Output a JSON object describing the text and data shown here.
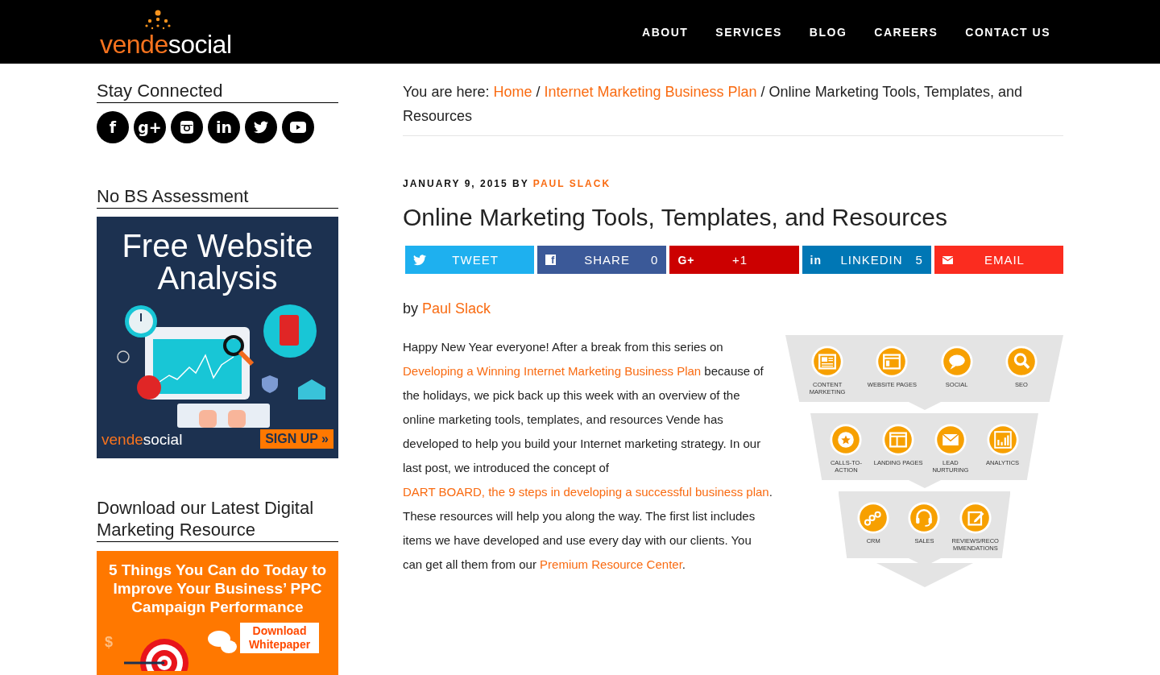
{
  "header": {
    "logo": {
      "first": "vende",
      "second": "social"
    },
    "nav": [
      {
        "label": "ABOUT"
      },
      {
        "label": "SERVICES"
      },
      {
        "label": "BLOG"
      },
      {
        "label": "CAREERS"
      },
      {
        "label": "CONTACT US"
      }
    ]
  },
  "sidebar": {
    "stay_connected": {
      "title": "Stay Connected",
      "icons": [
        {
          "kind": "glyph",
          "glyph": "f"
        },
        {
          "kind": "glyph",
          "glyph": "g+"
        },
        {
          "kind": "camera"
        },
        {
          "kind": "glyph",
          "glyph": "in"
        },
        {
          "kind": "bird"
        },
        {
          "kind": "play"
        }
      ]
    },
    "assessment": {
      "title": "No BS Assessment",
      "banner": {
        "headline": "Free Website Analysis",
        "logo_first": "vende",
        "logo_second": "social",
        "button": "SIGN UP »"
      }
    },
    "resource": {
      "title": "Download our Latest Digital Marketing Resource",
      "banner": {
        "headline": "5 Things You Can do Today to Improve Your Business’ PPC Campaign Performance",
        "button": "Download Whitepaper",
        "symbol": "$"
      }
    }
  },
  "breadcrumb": [
    {
      "text": "You are here: ",
      "link": false
    },
    {
      "text": "Home",
      "link": true
    },
    {
      "text": " / ",
      "link": false
    },
    {
      "text": "Internet Marketing Business Plan",
      "link": true
    },
    {
      "text": " / Online Marketing Tools, Templates, and Resources",
      "link": false
    }
  ],
  "post": {
    "date": "JANUARY 9, 2015",
    "by": "BY",
    "author": "PAUL SLACK",
    "title": "Online Marketing Tools, Templates, and Resources",
    "share": [
      {
        "kind": "bird",
        "label": "TWEET",
        "color": "#1eb0ef"
      },
      {
        "kind": "fbox",
        "glyph": "f",
        "label": "SHARE",
        "count": "0",
        "color": "#3b5998"
      },
      {
        "kind": "glyph",
        "glyph": "G+",
        "label": "+1",
        "color": "#cc0000"
      },
      {
        "kind": "glyph",
        "glyph": "in",
        "label": "LINKEDIN",
        "count": "5",
        "color": "#0077b5"
      },
      {
        "kind": "envelope",
        "label": "EMAIL",
        "color": "#fb2c1f"
      }
    ],
    "byline": [
      {
        "text": "by ",
        "link": false
      },
      {
        "text": "Paul Slack",
        "link": true
      }
    ],
    "paragraph": [
      {
        "text": "Happy New Year everyone! After a break from this series on ",
        "link": false
      },
      {
        "text": "Developing a Winning Internet Marketing Business Plan",
        "link": true
      },
      {
        "text": " because of the holidays, we pick back up this week with an overview of the online marketing tools, templates, and resources Vende has developed to help you build your Internet marketing strategy.  In our last post, we introduced the concept of ",
        "link": false
      },
      {
        "text": "DART BOARD, the 9 steps in developing a successful business plan",
        "link": true
      },
      {
        "text": ". These resources will help you along the way.  The first list includes items we have developed and use every day with our clients. You can get all them from our ",
        "link": false
      },
      {
        "text": "Premium Resource Center",
        "link": true
      },
      {
        "text": ".",
        "link": false
      }
    ],
    "funnel": [
      {
        "items": [
          {
            "label": "CONTENT MARKETING"
          },
          {
            "label": "WEBSITE PAGES"
          },
          {
            "label": "SOCIAL"
          },
          {
            "label": "SEO"
          }
        ]
      },
      {
        "items": [
          {
            "label": "CALLS-TO-ACTION"
          },
          {
            "label": "LANDING PAGES"
          },
          {
            "label": "LEAD NURTURING"
          },
          {
            "label": "ANALYTICS"
          }
        ]
      },
      {
        "items": [
          {
            "label": "CRM"
          },
          {
            "label": "SALES"
          },
          {
            "label": "REVIEWS/RECOMMENDATIONS"
          }
        ]
      }
    ]
  }
}
